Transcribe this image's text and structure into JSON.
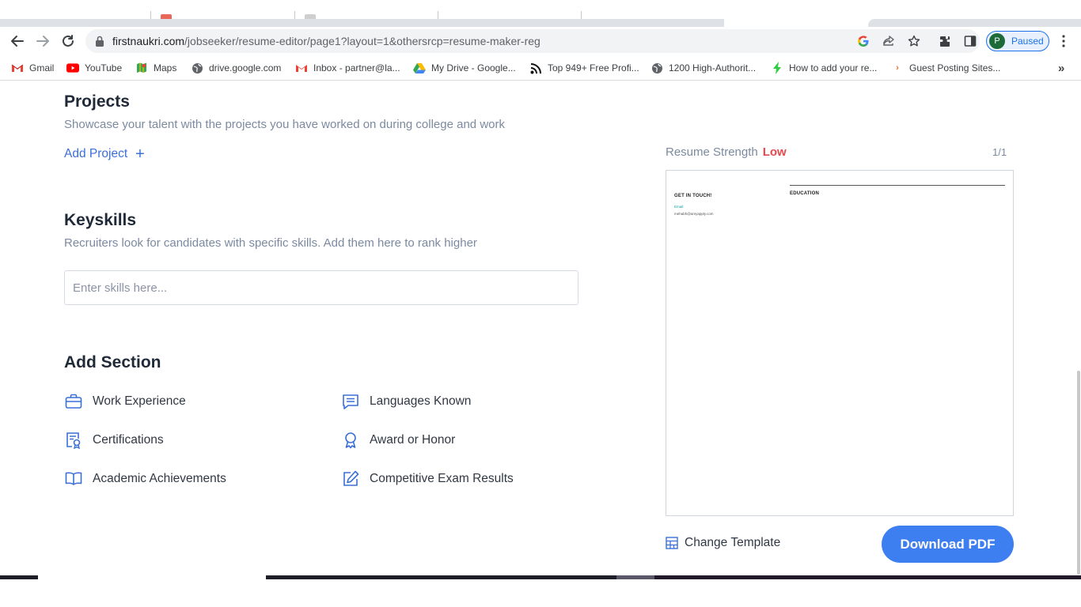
{
  "browser": {
    "url_host": "firstnaukri.com",
    "url_path": "/jobseeker/resume-editor/page1?layout=1&othersrcp=resume-maker-reg",
    "profile_initial": "P",
    "profile_status": "Paused"
  },
  "bookmarks": [
    {
      "label": "Gmail",
      "icon": "gmail-icon"
    },
    {
      "label": "YouTube",
      "icon": "youtube-icon"
    },
    {
      "label": "Maps",
      "icon": "maps-icon"
    },
    {
      "label": "drive.google.com",
      "icon": "globe-icon"
    },
    {
      "label": "Inbox - partner@la...",
      "icon": "gmail-icon"
    },
    {
      "label": "My Drive - Google...",
      "icon": "drive-icon"
    },
    {
      "label": "Top 949+ Free Profi...",
      "icon": "feed-icon"
    },
    {
      "label": "1200 High-Authorit...",
      "icon": "globe-icon"
    },
    {
      "label": "How to add your re...",
      "icon": "bolt-icon"
    },
    {
      "label": "Guest Posting Sites...",
      "icon": "arrow-icon"
    }
  ],
  "projects": {
    "title": "Projects",
    "subtitle": "Showcase your talent with the projects you have worked on during college and work",
    "add_label": "Add Project"
  },
  "keyskills": {
    "title": "Keyskills",
    "subtitle": "Recruiters look for candidates with specific skills. Add them here to rank higher",
    "placeholder": "Enter skills here..."
  },
  "add_section": {
    "title": "Add Section",
    "items": [
      {
        "label": "Work Experience",
        "icon": "briefcase-icon"
      },
      {
        "label": "Languages Known",
        "icon": "chat-icon"
      },
      {
        "label": "Certifications",
        "icon": "certificate-icon"
      },
      {
        "label": "Award or Honor",
        "icon": "award-icon"
      },
      {
        "label": "Academic Achievements",
        "icon": "book-icon"
      },
      {
        "label": "Competitive Exam Results",
        "icon": "edit-icon"
      }
    ]
  },
  "preview": {
    "strength_label": "Resume Strength",
    "strength_value": "Low",
    "pages": "1/1",
    "education_heading": "EDUCATION",
    "contact_heading": "GET IN TOUCH!",
    "email_label": "Email:",
    "email_value": "mehabh@amyapply.com"
  },
  "actions": {
    "change_template": "Change Template",
    "download_pdf": "Download PDF"
  },
  "colors": {
    "accent": "#3d7ef0",
    "link": "#3b6fd8",
    "strength_low": "#e5484d"
  }
}
